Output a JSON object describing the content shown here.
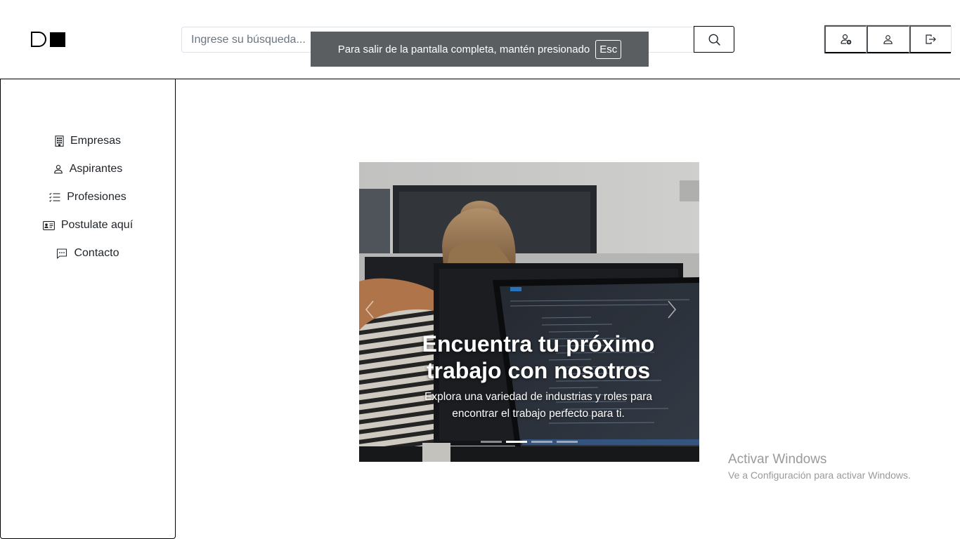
{
  "header": {
    "search": {
      "placeholder": "Ingrese su búsqueda...",
      "value": ""
    },
    "search_button_icon": "search-icon",
    "user_buttons": [
      {
        "icon": "person-add-icon"
      },
      {
        "icon": "person-icon"
      },
      {
        "icon": "logout-icon"
      }
    ]
  },
  "fullscreen_notice": {
    "text": "Para salir de la pantalla completa, mantén presionado",
    "key": "Esc"
  },
  "sidebar": {
    "items": [
      {
        "label": "Empresas",
        "icon": "building-icon"
      },
      {
        "label": "Aspirantes",
        "icon": "person-icon"
      },
      {
        "label": "Profesiones",
        "icon": "list-check-icon"
      },
      {
        "label": "Postulate aquí",
        "icon": "id-card-icon"
      },
      {
        "label": "Contacto",
        "icon": "chat-icon"
      }
    ]
  },
  "carousel": {
    "title": "Encuentra tu próximo trabajo con nosotros",
    "text": "Explora una variedad de industrias y roles para encontrar el trabajo perfecto para ti.",
    "slide_count": 4,
    "active_slide": 2
  },
  "watermark": {
    "title": "Activar Windows",
    "subtitle": "Ve a Configuración para activar Windows."
  }
}
